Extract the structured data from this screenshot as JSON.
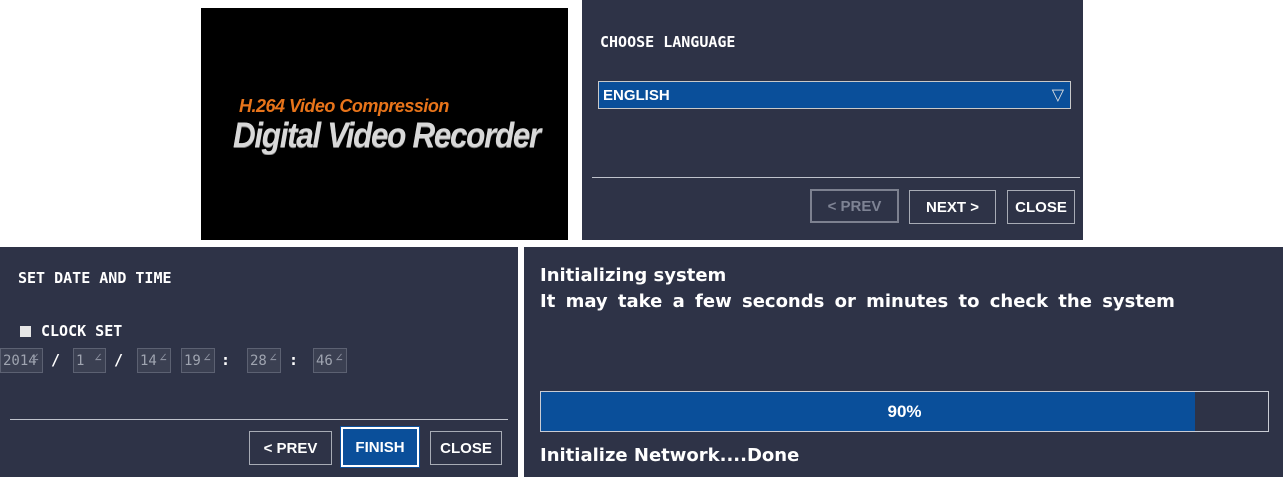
{
  "splash": {
    "subtitle": "H.264 Video Compression",
    "title": "Digital Video Recorder"
  },
  "language_dialog": {
    "title": "CHOOSE LANGUAGE",
    "selected_language": "ENGLISH",
    "prev_label": "< PREV",
    "next_label": "NEXT >",
    "close_label": "CLOSE"
  },
  "datetime_dialog": {
    "title": "SET DATE AND TIME",
    "clock_set_label": "CLOCK SET",
    "year": "2014",
    "month": "1",
    "day": "14",
    "hour": "19",
    "minute": "28",
    "second": "46",
    "date_sep": "/",
    "time_sep": ":",
    "spinner_glyph": "∠",
    "prev_label": "< PREV",
    "finish_label": "FINISH",
    "close_label": "CLOSE"
  },
  "init_dialog": {
    "line1": "Initializing system",
    "line2": "It may take a few seconds or minutes to check the system",
    "progress_value": 0.9,
    "progress_label": "90%",
    "status": "Initialize Network....Done"
  },
  "colors": {
    "dialog_bg": "#2e3347",
    "accent_blue": "#0a4f9a",
    "splash_orange": "#e8741a"
  }
}
